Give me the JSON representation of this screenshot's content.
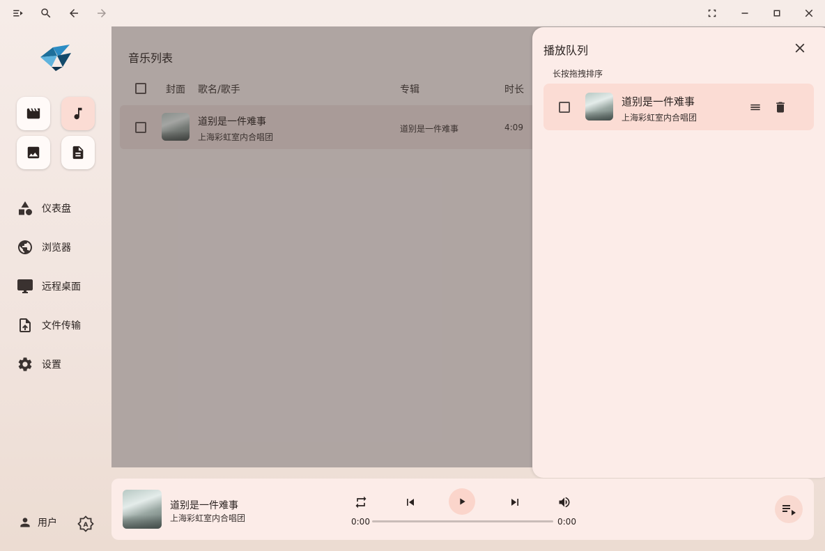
{
  "titlebar": {
    "icons": [
      "menu-collapse-icon",
      "search-icon",
      "arrow-left-icon",
      "arrow-right-icon",
      "fullscreen-icon",
      "minimize-icon",
      "maximize-icon",
      "close-icon"
    ]
  },
  "sidebar": {
    "apps": [
      "video-app",
      "music-app",
      "image-app",
      "document-app"
    ],
    "active_app": "music-app",
    "nav": [
      {
        "label": "仪表盘",
        "icon": "shapes-icon"
      },
      {
        "label": "浏览器",
        "icon": "globe-icon"
      },
      {
        "label": "远程桌面",
        "icon": "monitor-icon"
      },
      {
        "label": "文件传输",
        "icon": "file-upload-icon"
      },
      {
        "label": "设置",
        "icon": "gear-icon"
      }
    ],
    "user_label": "用户"
  },
  "music_list": {
    "title": "音乐列表",
    "columns": {
      "cover": "封面",
      "name": "歌名/歌手",
      "album": "专辑",
      "duration": "时长"
    },
    "rows": [
      {
        "name": "道别是一件难事",
        "artist": "上海彩虹室内合唱团",
        "album": "道别是一件难事",
        "duration": "4:09"
      }
    ]
  },
  "queue": {
    "title": "播放队列",
    "hint": "长按拖拽排序",
    "items": [
      {
        "name": "道别是一件难事",
        "artist": "上海彩虹室内合唱团"
      }
    ]
  },
  "player": {
    "name": "道别是一件难事",
    "artist": "上海彩虹室内合唱团",
    "current_time": "0:00",
    "total_time": "0:00",
    "progress": 0
  },
  "colors": {
    "accent": "#fbdcd4",
    "panel": "#fcece8",
    "text": "#2a2220"
  }
}
